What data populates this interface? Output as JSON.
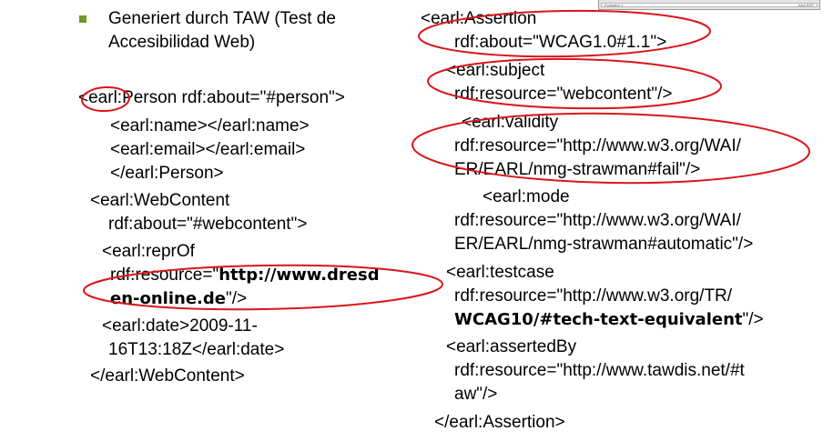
{
  "bullet": {
    "line1": "Generiert durch TAW (Test de",
    "line2": "Accesibilidad Web)"
  },
  "person": {
    "l1_prefix": "<",
    "l1_rest": "earl:Person rdf:about=\"#person\">",
    "l2": "<earl:name></earl:name>",
    "l3": "<earl:email></earl:email>",
    "l4": "</earl:Person>"
  },
  "webcontent": {
    "l1": "<earl:WebContent",
    "l2": "rdf:about=\"#webcontent\">",
    "l3": "<earl:reprOf",
    "l4_prefix": "rdf:resource=\"",
    "l4_bold": "http://www.dresd",
    "l5_bold": "en-online.de",
    "l5_suffix": "\"/>",
    "l6": "<earl:date>2009-11-",
    "l7": "16T13:18Z</earl:date>",
    "l8": "</earl:WebContent>"
  },
  "assertion": {
    "l1": "<earl:Assertion",
    "l2": "rdf:about=\"WCAG1.0#1.1\">",
    "l3": "<earl:subject",
    "l4": "rdf:resource=\"webcontent\"/>",
    "l5": "<earl:validity",
    "l6": "rdf:resource=\"http://www.w3.org/WAI/",
    "l7": "ER/EARL/nmg-strawman#fail\"/>",
    "l8": "<earl:mode",
    "l9": "rdf:resource=\"http://www.w3.org/WAI/",
    "l10": "ER/EARL/nmg-strawman#automatic\"/>",
    "l11": "<earl:testcase",
    "l12": "rdf:resource=\"http://www.w3.org/TR/",
    "l13_bold": "WCAG10/#tech-text-equivalent",
    "l13_suffix": "\"/>",
    "l14": "<earl:assertedBy",
    "l15": "rdf:resource=\"http://www.tawdis.net/#t",
    "l16": "aw\"/>",
    "l17": "</earl:Assertion>"
  },
  "thumbnail": {
    "left_label": "Evaluator 1",
    "right_label": "AAA  RDF"
  },
  "colors": {
    "bullet": "#6a9a2a",
    "annotation": "#d8161c",
    "text": "#000000"
  }
}
